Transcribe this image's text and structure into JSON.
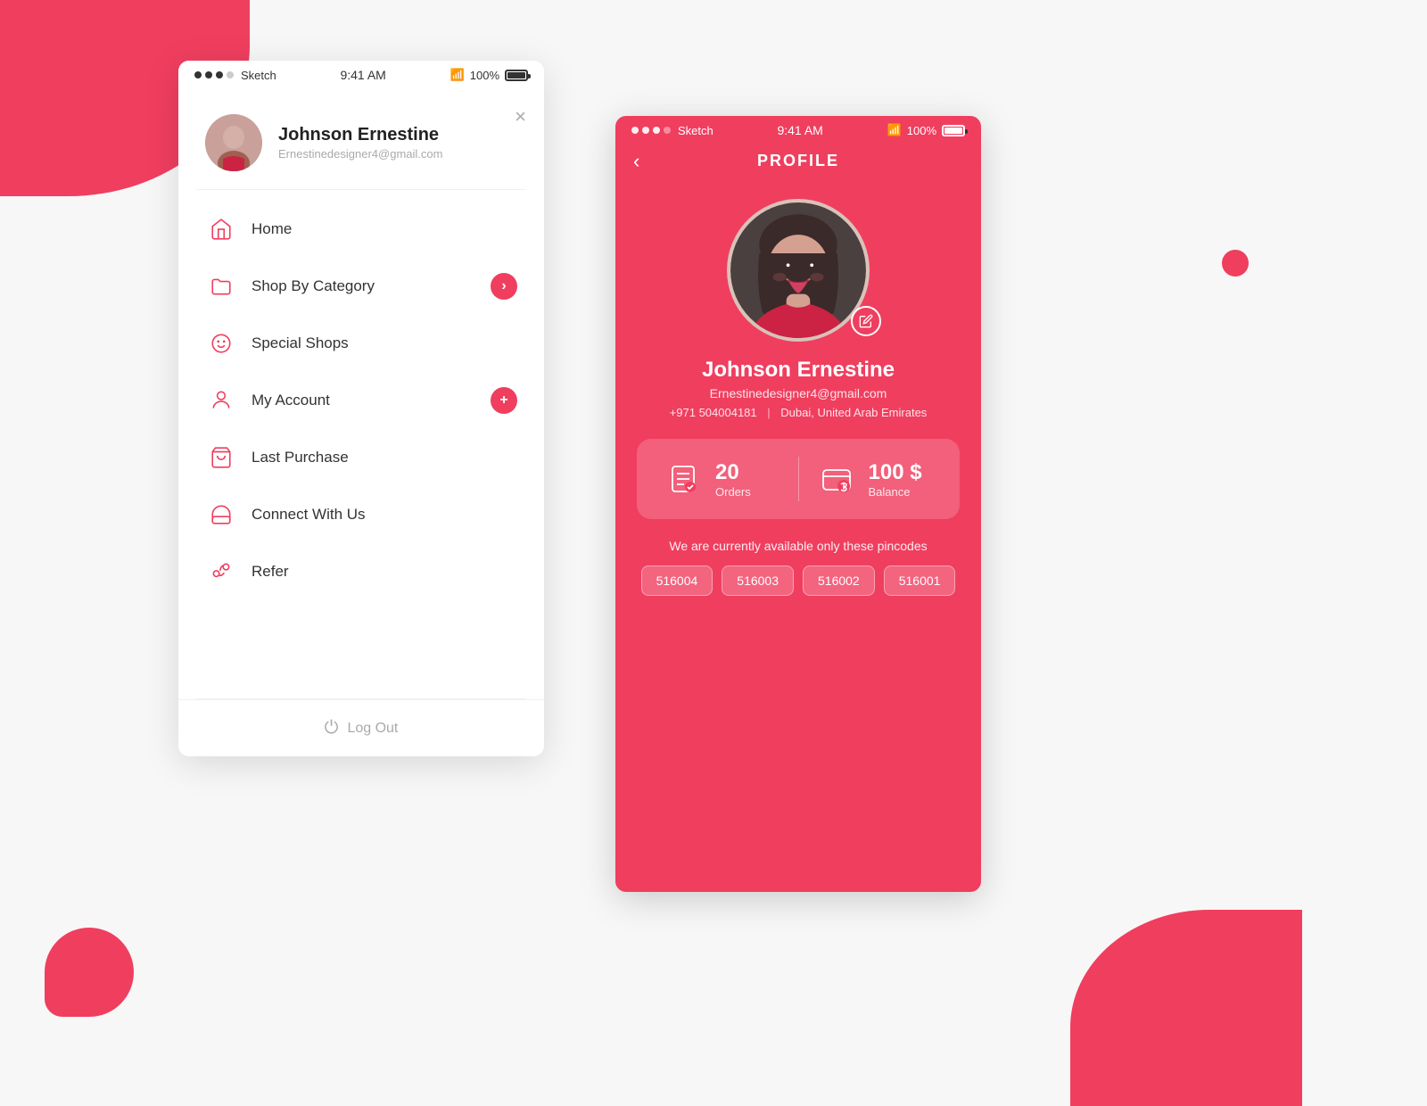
{
  "background": {
    "color": "#f7f7f7"
  },
  "left_phone": {
    "status_bar": {
      "app_name": "Sketch",
      "time": "9:41 AM",
      "wifi": "WiFi",
      "battery": "100%"
    },
    "close_button": "×",
    "user": {
      "name": "Johnson Ernestine",
      "email": "Ernestinedesigner4@gmail.com"
    },
    "menu_items": [
      {
        "id": "home",
        "label": "Home",
        "icon": "home-icon",
        "badge": null
      },
      {
        "id": "shop-by-category",
        "label": "Shop By Category",
        "icon": "folder-icon",
        "badge": "arrow"
      },
      {
        "id": "special-shops",
        "label": "Special Shops",
        "icon": "smiley-icon",
        "badge": null
      },
      {
        "id": "my-account",
        "label": "My Account",
        "icon": "account-icon",
        "badge": "plus"
      },
      {
        "id": "last-purchase",
        "label": "Last Purchase",
        "icon": "basket-icon",
        "badge": null
      },
      {
        "id": "connect-with-us",
        "label": "Connect With Us",
        "icon": "headset-icon",
        "badge": null
      },
      {
        "id": "refer",
        "label": "Refer",
        "icon": "refer-icon",
        "badge": null
      }
    ],
    "logout_label": "Log Out"
  },
  "right_phone": {
    "status_bar": {
      "app_name": "Sketch",
      "time": "9:41 AM",
      "wifi": "WiFi",
      "battery": "100%"
    },
    "back_button": "‹",
    "title": "PROFILE",
    "user": {
      "name": "Johnson Ernestine",
      "email": "Ernestinedesigner4@gmail.com",
      "phone": "+971 504004181",
      "location": "Dubai, United Arab Emirates"
    },
    "stats": {
      "orders": {
        "count": "20",
        "label": "Orders"
      },
      "balance": {
        "amount": "100 $",
        "label": "Balance"
      }
    },
    "pincodes_title": "We are currently available only these pincodes",
    "pincodes": [
      "516004",
      "516003",
      "516002",
      "516001"
    ]
  }
}
